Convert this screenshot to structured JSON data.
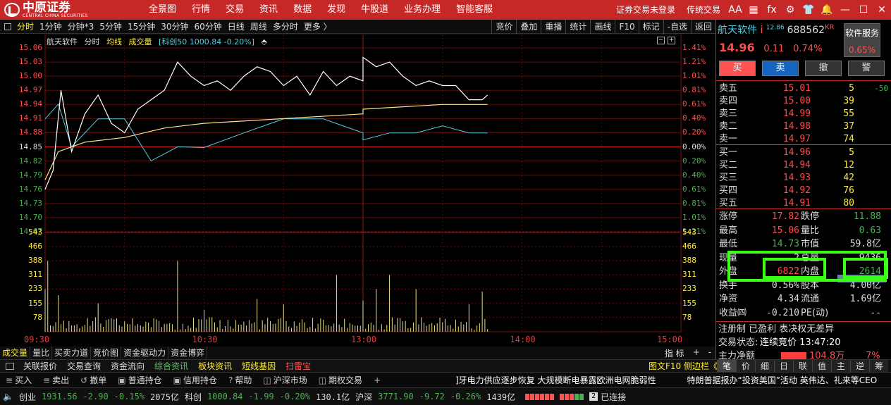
{
  "app": {
    "logo_text": "中原证券",
    "logo_sub": "CENTRAL CHINA SECURITIES",
    "menu": [
      "全景图",
      "行情",
      "交易",
      "资讯",
      "数据",
      "发现",
      "牛股道",
      "业务办理",
      "智能客服"
    ],
    "login_status": "证券交易未登录",
    "trad_trade": "传统交易",
    "icons": [
      "font-size-icon",
      "grid-icon",
      "formula-icon",
      "gear-icon",
      "shirt-icon",
      "bell-icon",
      "minimize-icon",
      "maximize-icon",
      "close-icon"
    ],
    "icon_glyphs": [
      "AA",
      "▦",
      "fx",
      "⚙",
      "👕",
      "🔔",
      "—",
      "☐",
      "✕"
    ]
  },
  "toolbar": {
    "periods": [
      "分时",
      "1分钟",
      "分钟*3",
      "5分钟",
      "15分钟",
      "30分钟",
      "60分钟",
      "日线",
      "周线",
      "多分时",
      "更多 〉"
    ],
    "active_index": 0,
    "right": [
      "竞价",
      "叠加",
      "重播",
      "统计",
      "画线",
      "F10",
      "标记",
      "-自选",
      "返回"
    ]
  },
  "chart": {
    "info": {
      "name": "航天软件",
      "mode": "分时",
      "avg_label": "均线",
      "vol_label": "成交量",
      "index_label": "[科创50 1000.84 -0.20%]"
    },
    "price_ticks": [
      "15.06",
      "15.03",
      "15.00",
      "14.97",
      "14.94",
      "14.91",
      "14.88",
      "14.85",
      "14.82",
      "14.79",
      "14.76",
      "14.73",
      "14.70",
      "14.67"
    ],
    "pct_ticks": [
      "1.41%",
      "1.21%",
      "1.01%",
      "0.81%",
      "0.61%",
      "0.40%",
      "0.20%",
      "0.00%",
      "0.20%",
      "0.40%",
      "0.61%",
      "0.81%",
      "1.01%",
      "1.21%"
    ],
    "vol_ticks": [
      "543",
      "466",
      "388",
      "311",
      "233",
      "155",
      "78"
    ],
    "time_ticks": [
      "09:30",
      "10:30",
      "13:00",
      "14:00",
      "15:00"
    ],
    "colors": {
      "up": "#ff4c4c",
      "down": "#4caf50",
      "flat": "#ddd",
      "price_line": "#ffffff",
      "avg_line": "#f6e58d",
      "index_line": "#4dd0e1",
      "volume": "#e8e08a"
    }
  },
  "chart_data": {
    "type": "line",
    "title": "航天软件 分时",
    "xlabel": "",
    "ylabel": "",
    "x_range": [
      "09:30",
      "15:00"
    ],
    "ylim": [
      14.67,
      15.06
    ],
    "volume_ylim": [
      0,
      543
    ],
    "series": [
      {
        "name": "分时",
        "x": [
          "09:30",
          "09:33",
          "09:36",
          "09:40",
          "09:45",
          "09:50",
          "09:55",
          "10:00",
          "10:05",
          "10:10",
          "10:15",
          "10:20",
          "10:25",
          "10:30",
          "10:35",
          "10:40",
          "10:45",
          "10:50",
          "10:55",
          "11:00",
          "11:05",
          "11:10",
          "11:15",
          "11:20",
          "11:25",
          "11:30",
          "13:00",
          "13:05",
          "13:10",
          "13:15",
          "13:20",
          "13:25",
          "13:30",
          "13:35",
          "13:40",
          "13:45",
          "13:47"
        ],
        "values": [
          14.76,
          14.8,
          14.97,
          14.84,
          14.92,
          14.96,
          14.9,
          14.88,
          14.93,
          14.95,
          14.97,
          15.03,
          15.0,
          14.98,
          14.99,
          14.97,
          15.0,
          15.02,
          15.01,
          14.98,
          15.0,
          14.96,
          15.01,
          14.98,
          15.0,
          14.99,
          15.04,
          15.02,
          15.03,
          15.0,
          14.98,
          14.99,
          14.98,
          14.98,
          14.95,
          14.95,
          14.96
        ]
      },
      {
        "name": "均线",
        "x": [
          "09:30",
          "09:35",
          "09:45",
          "10:00",
          "10:15",
          "10:30",
          "11:00",
          "11:30",
          "13:00",
          "13:30",
          "13:47"
        ],
        "values": [
          14.78,
          14.84,
          14.86,
          14.87,
          14.89,
          14.9,
          14.91,
          14.92,
          14.93,
          14.94,
          14.94
        ]
      },
      {
        "name": "科创50",
        "x": [
          "09:30",
          "09:35",
          "09:40",
          "09:50",
          "10:00",
          "10:10",
          "10:20",
          "10:30",
          "10:45",
          "11:00",
          "11:15",
          "11:30",
          "13:00",
          "13:10",
          "13:20",
          "13:30",
          "13:40",
          "13:47"
        ],
        "values": [
          0.4,
          0.61,
          0.0,
          0.4,
          0.4,
          -0.2,
          0.0,
          -0.01,
          0.2,
          0.4,
          0.4,
          0.2,
          0.1,
          0.2,
          0.2,
          0.3,
          0.2,
          0.2
        ]
      },
      {
        "name": "成交量",
        "x": [
          "09:30",
          "09:31",
          "09:35",
          "09:50",
          "10:20",
          "10:30",
          "10:50",
          "11:00",
          "11:20",
          "13:00",
          "13:05",
          "13:10",
          "13:20",
          "13:40",
          "13:45"
        ],
        "values": [
          233,
          388,
          200,
          155,
          388,
          120,
          180,
          150,
          311,
          170,
          233,
          311,
          233,
          150,
          220
        ]
      }
    ]
  },
  "subtabs": {
    "items": [
      "成交量",
      "量比",
      "买卖力道",
      "竞价图",
      "资金驱动力",
      "资金博弈"
    ],
    "active_index": 0,
    "right": [
      "指 标",
      "+",
      "-"
    ]
  },
  "funcbar": {
    "items": [
      "关联报价",
      "交易查询",
      "资金流向",
      "综合资讯",
      "板块资讯",
      "短线基因",
      "扫雷宝"
    ],
    "right": "图文F10 侧边栏《",
    "rtabs": [
      "笔",
      "价",
      "细",
      "日",
      "联",
      "值",
      "主",
      "逆",
      "筹"
    ]
  },
  "actionbar": {
    "items": [
      {
        "icon": "≡",
        "label": "买入"
      },
      {
        "icon": "≡",
        "label": "卖出"
      },
      {
        "icon": "↺",
        "label": "撤单"
      },
      {
        "icon": "▣",
        "label": "普通持仓"
      },
      {
        "icon": "▣",
        "label": "信用持仓"
      },
      {
        "icon": "?",
        "label": "帮助"
      },
      {
        "icon": "◫",
        "label": "沪深市场"
      },
      {
        "icon": "◫",
        "label": "期权交易"
      },
      {
        "icon": "+",
        "label": ""
      }
    ],
    "news": [
      "]牙电力供应逐步恢复 大规模断电暴露欧洲电网脆弱性",
      "特朗普据报办“投资美国”活动 英伟达、礼来等CEO"
    ]
  },
  "statusbar": {
    "cy_label": "创业",
    "cy_value": "1931.56",
    "cy_change": "-2.90",
    "cy_pct": "-0.15%",
    "cy_amount": "2075亿",
    "kc_label": "科创",
    "kc_value": "1000.84",
    "kc_change": "-1.99",
    "kc_pct": "-0.20%",
    "kc_amount": "130.1亿",
    "hs_label": "沪深",
    "hs_value": "3771.90",
    "hs_change": "-9.72",
    "hs_pct": "-0.26%",
    "hs_amount": "1439亿",
    "connected": "已连接",
    "conn_count": "2"
  },
  "quote": {
    "name": "航天软件",
    "flag": "i",
    "super": "12.86",
    "code": "688562",
    "market_tag": "KR",
    "service_btn": "软件服务",
    "service_pct": "0.65%",
    "price": "14.96",
    "change": "0.11",
    "pct": "0.74%",
    "buttons": [
      "买",
      "卖",
      "撤",
      "警"
    ]
  },
  "orderbook": {
    "asks": [
      {
        "label": "卖五",
        "price": "15.01",
        "vol": "5",
        "chg": "-50"
      },
      {
        "label": "卖四",
        "price": "15.00",
        "vol": "39",
        "chg": ""
      },
      {
        "label": "卖三",
        "price": "14.99",
        "vol": "55",
        "chg": ""
      },
      {
        "label": "卖二",
        "price": "14.98",
        "vol": "37",
        "chg": ""
      },
      {
        "label": "卖一",
        "price": "14.97",
        "vol": "74",
        "chg": ""
      }
    ],
    "bids": [
      {
        "label": "买一",
        "price": "14.96",
        "vol": "5"
      },
      {
        "label": "买二",
        "price": "14.94",
        "vol": "12"
      },
      {
        "label": "买三",
        "price": "14.93",
        "vol": "42"
      },
      {
        "label": "买四",
        "price": "14.92",
        "vol": "76"
      },
      {
        "label": "买五",
        "price": "14.91",
        "vol": "80"
      }
    ]
  },
  "stats": {
    "rows": [
      {
        "l1": "涨停",
        "v1": "17.82",
        "c1": "r",
        "l2": "跌停",
        "v2": "11.88",
        "c2": "g"
      },
      {
        "l1": "最高",
        "v1": "15.06",
        "c1": "r",
        "l2": "量比",
        "v2": "0.63",
        "c2": "g"
      },
      {
        "l1": "最低",
        "v1": "14.73",
        "c1": "g",
        "l2": "市值",
        "v2": "59.8亿",
        "c2": "w"
      },
      {
        "l1": "现量",
        "v1": "2",
        "c1": "w",
        "l2": "总量",
        "v2": "9436",
        "c2": "w"
      },
      {
        "l1": "外盘",
        "v1": "6822",
        "c1": "r",
        "l2": "内盘",
        "v2": "2614",
        "c2": "g"
      },
      {
        "l1": "换手",
        "v1": "0.56%",
        "c1": "w",
        "l2": "股本",
        "v2": "4.00亿",
        "c2": "w"
      },
      {
        "l1": "净资",
        "v1": "4.34",
        "c1": "w",
        "l2": "流通",
        "v2": "1.69亿",
        "c2": "w"
      },
      {
        "l1": "收益㈣",
        "v1": "-0.210",
        "c1": "w",
        "l2": "PE(动)",
        "v2": "--",
        "c2": "w"
      }
    ],
    "tags": "注册制 已盈利 表决权无差异",
    "trade_state_label": "交易状态:",
    "trade_state": "连续竞价 13:47:20",
    "main_flow_label": "主力净额",
    "main_flow_value": "104.8万",
    "main_flow_pct": "7%"
  }
}
